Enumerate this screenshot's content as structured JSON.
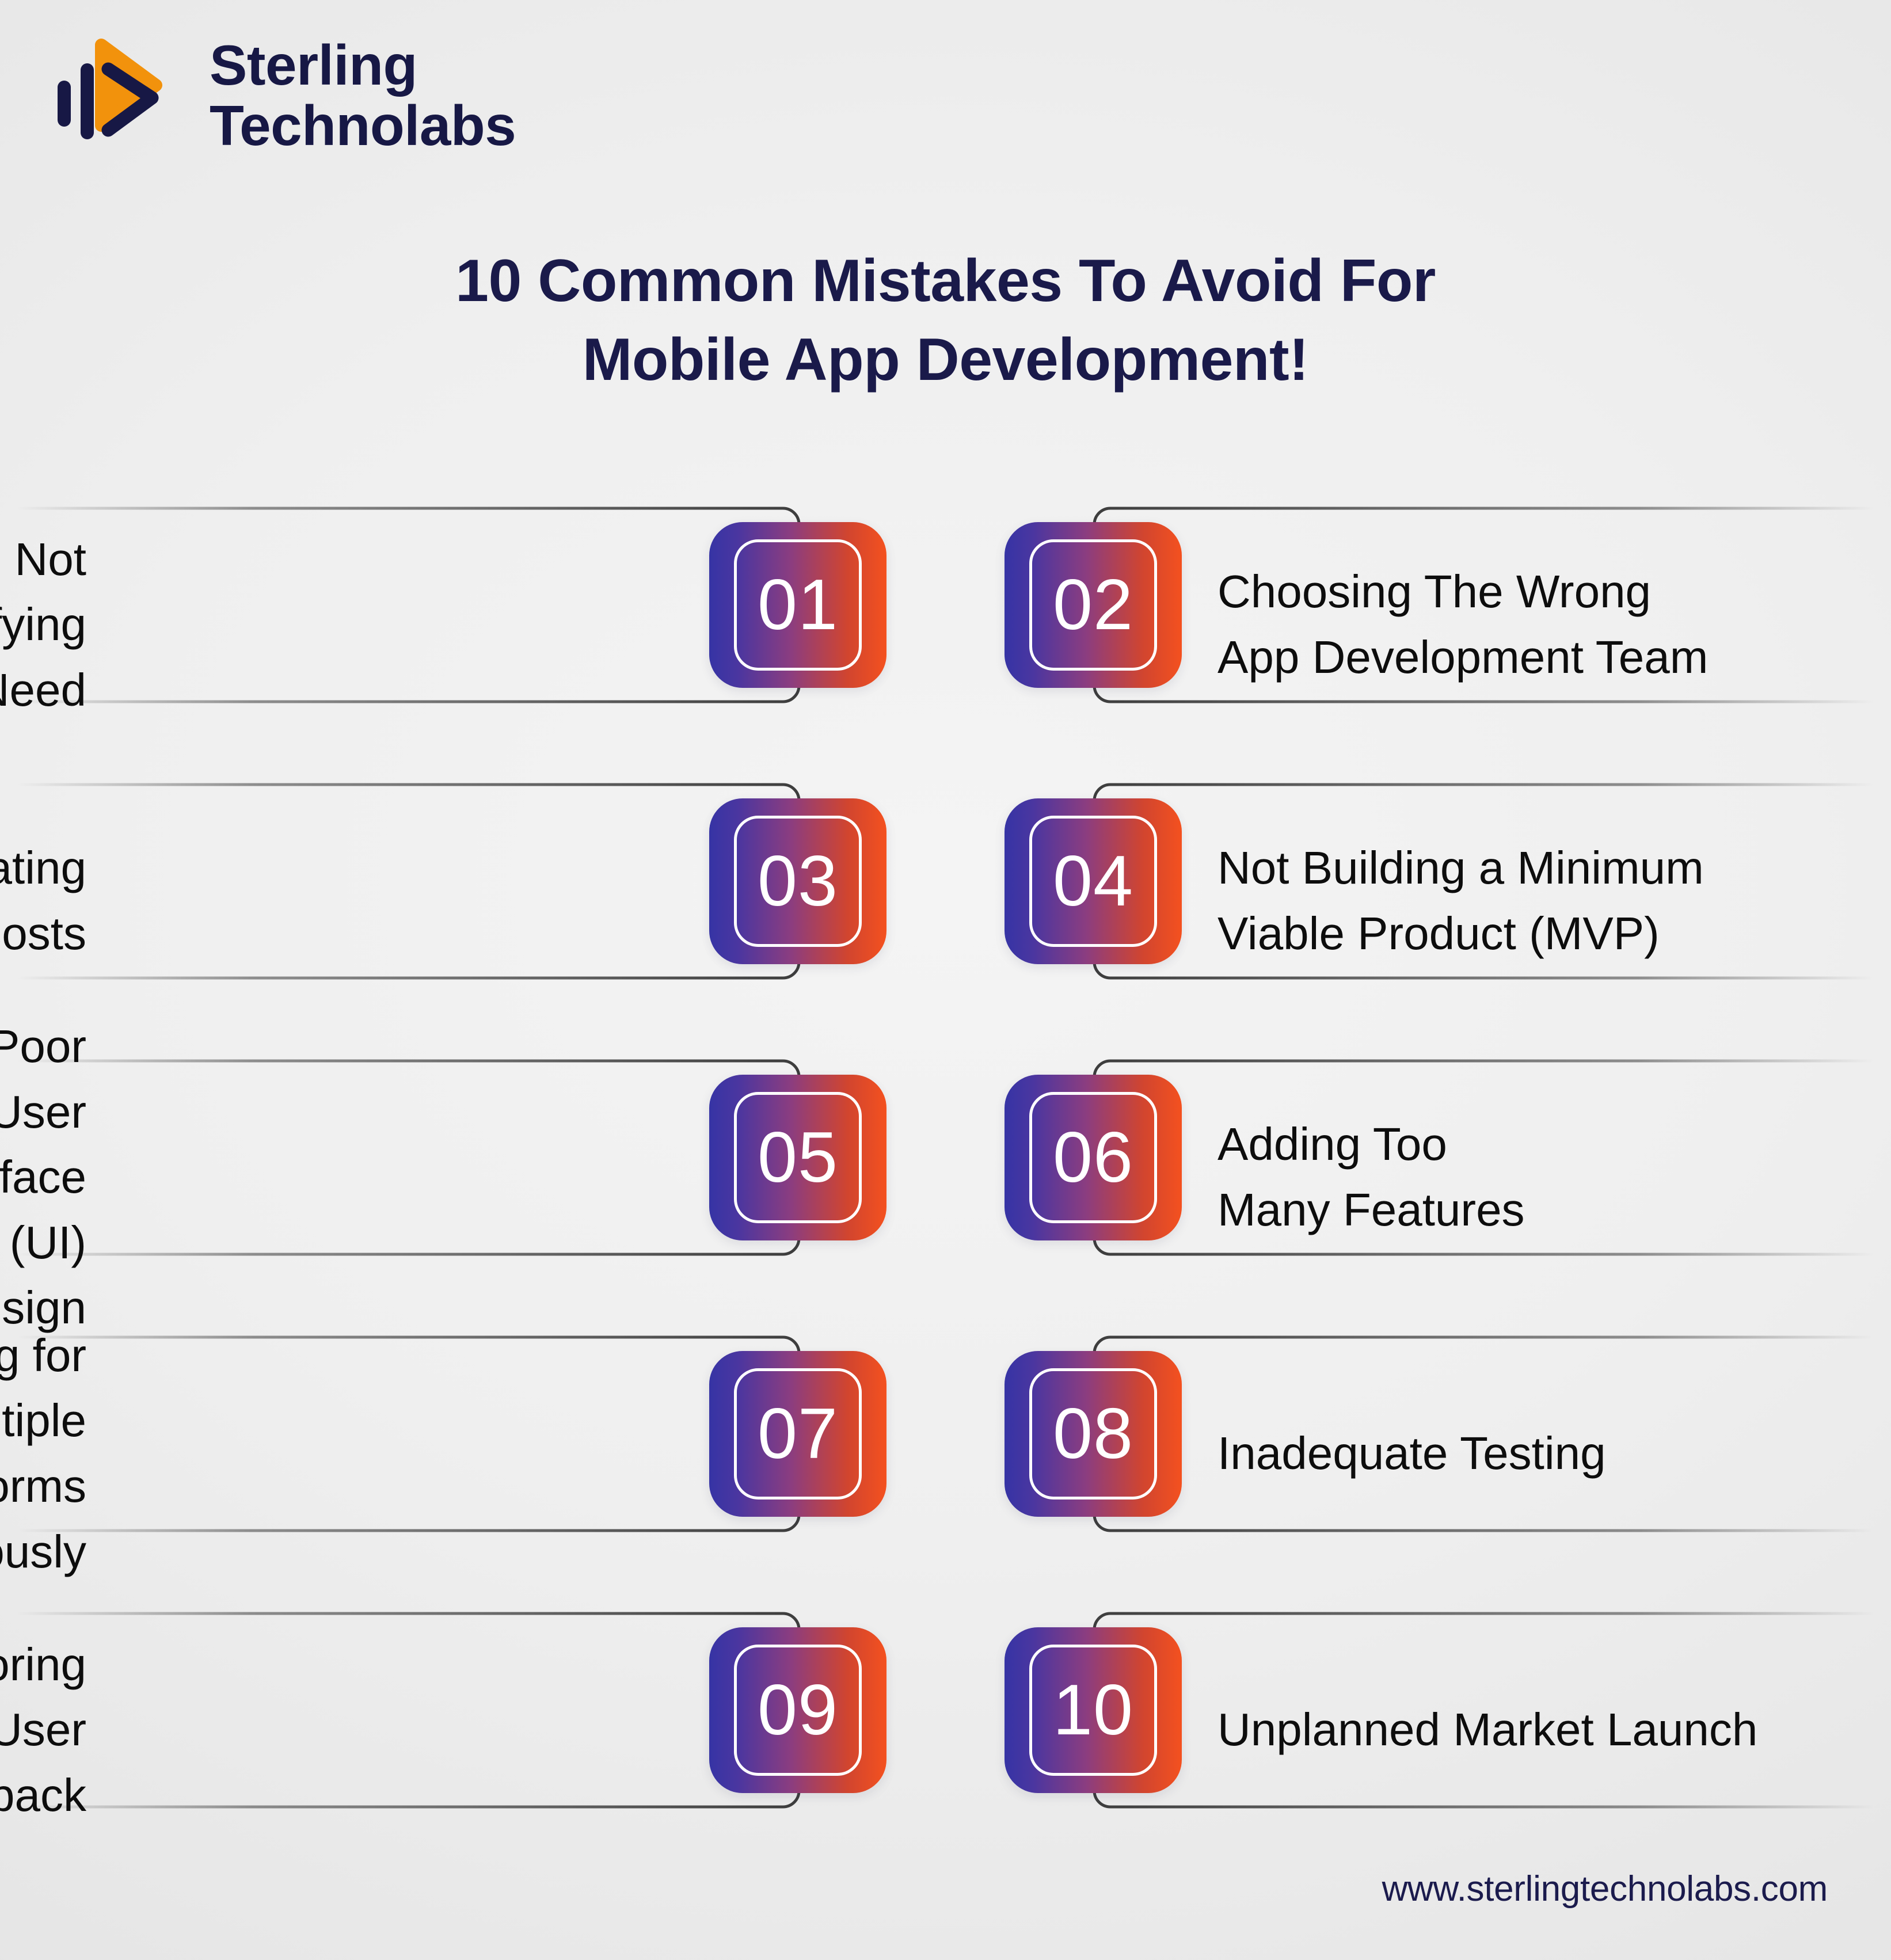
{
  "brand": {
    "name_line1": "Sterling",
    "name_line2": "Technolabs",
    "logo_icon": "sterling-play-bars-logo",
    "navy": "#171845",
    "orange": "#F2920C"
  },
  "title": {
    "line1": "10 Common Mistakes To Avoid For",
    "line2": "Mobile App Development!"
  },
  "badge_style": {
    "gradient_from": "#3634A5",
    "gradient_to": "#F4511F",
    "number_color": "#FFFFFF"
  },
  "items": [
    {
      "number": "01",
      "side": "left",
      "line1": "Not Identifying",
      "line2": "The Need"
    },
    {
      "number": "02",
      "side": "right",
      "line1": "Choosing The Wrong",
      "line2": "App Development Team"
    },
    {
      "number": "03",
      "side": "left",
      "line1": "Underestimating",
      "line2": "Total Costs"
    },
    {
      "number": "04",
      "side": "right",
      "line1": "Not Building a Minimum",
      "line2": "Viable Product (MVP)"
    },
    {
      "number": "05",
      "side": "left",
      "line1": "Poor User Interface",
      "line2": "(UI) Design"
    },
    {
      "number": "06",
      "side": "right",
      "line1": "Adding Too",
      "line2": "Many Features"
    },
    {
      "number": "07",
      "side": "left",
      "line1": "Developing for Multiple",
      "line2": "Platforms Simultaneously"
    },
    {
      "number": "08",
      "side": "right",
      "line1": "Inadequate Testing",
      "line2": ""
    },
    {
      "number": "09",
      "side": "left",
      "line1": "Ignoring User",
      "line2": "Feedback"
    },
    {
      "number": "10",
      "side": "right",
      "line1": "Unplanned Market Launch",
      "line2": ""
    }
  ],
  "footer": {
    "website": "www.sterlingtechnolabs.com"
  }
}
